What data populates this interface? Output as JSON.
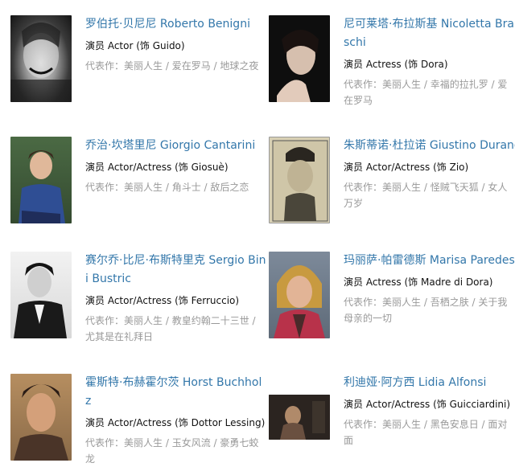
{
  "works_label": "代表作：",
  "cast": [
    {
      "name": "罗伯托·贝尼尼 Roberto Benigni",
      "role": "演员 Actor (饰 Guido)",
      "works": "美丽人生 / 爱在罗马 / 地球之夜",
      "photo_colors": [
        "#f0f0f0",
        "#2a2a2a"
      ]
    },
    {
      "name": "尼可莱塔·布拉斯基 Nicoletta Braschi",
      "role": "演员 Actress (饰 Dora)",
      "works": "美丽人生 / 幸福的拉扎罗 / 爱在罗马",
      "photo_colors": [
        "#0d0d0d",
        "#d8c3b3"
      ]
    },
    {
      "name": "乔治·坎塔里尼 Giorgio Cantarini",
      "role": "演员 Actor/Actress (饰 Giosuè)",
      "works": "美丽人生 / 角斗士 / 敌后之恋",
      "photo_colors": [
        "#3f5a3a",
        "#2f4f9a"
      ]
    },
    {
      "name": "朱斯蒂诺·杜拉诺 Giustino Durano",
      "role": "演员 Actor/Actress (饰 Zio)",
      "works": "美丽人生 / 怪贼飞天狐 / 女人万岁",
      "photo_colors": [
        "#c8bea0",
        "#4a463a"
      ]
    },
    {
      "name": "赛尔乔·比尼·布斯特里克 Sergio Bini Bustric",
      "role": "演员 Actor/Actress (饰 Ferruccio)",
      "works": "美丽人生 / 教皇约翰二十三世 / 尤其是在礼拜日",
      "photo_colors": [
        "#eeeeee",
        "#1a1a1a"
      ]
    },
    {
      "name": "玛丽萨·帕雷德斯 Marisa Paredes",
      "role": "演员 Actress (饰 Madre di Dora)",
      "works": "美丽人生 / 吾栖之肤 / 关于我母亲的一切",
      "photo_colors": [
        "#6e7b8c",
        "#c59a3a"
      ]
    },
    {
      "name": "霍斯特·布赫霍尔茨 Horst Buchholz",
      "role": "演员 Actor/Actress (饰 Dottor Lessing)",
      "works": "美丽人生 / 玉女风流 / 豪勇七蛟龙",
      "photo_colors": [
        "#c49a6a",
        "#3d2a22"
      ]
    },
    {
      "name": "利迪娅·阿方西 Lidia Alfonsi",
      "role": "演员 Actor/Actress (饰 Guicciardini)",
      "works": "美丽人生 / 黑色安息日 / 面对面",
      "photo_colors": [
        "#2b2420",
        "#6a5040"
      ]
    }
  ]
}
